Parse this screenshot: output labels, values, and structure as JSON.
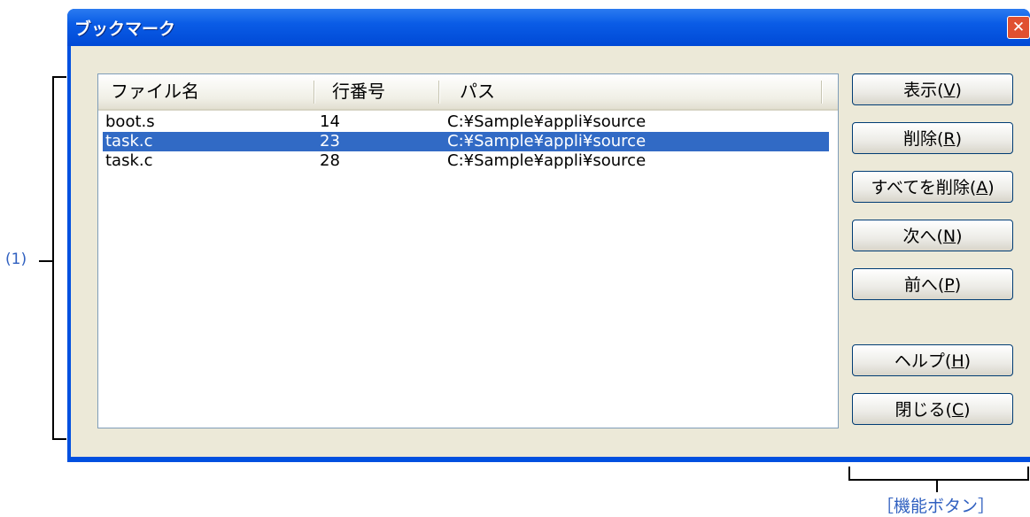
{
  "window": {
    "title": "ブックマーク",
    "close_icon": "close-icon"
  },
  "list": {
    "columns": [
      "ファイル名",
      "行番号",
      "パス"
    ],
    "rows": [
      {
        "file": "boot.s",
        "line": "14",
        "path": "C:¥Sample¥appli¥source",
        "selected": false
      },
      {
        "file": "task.c",
        "line": "23",
        "path": "C:¥Sample¥appli¥source",
        "selected": true
      },
      {
        "file": "task.c",
        "line": "28",
        "path": "C:¥Sample¥appli¥source",
        "selected": false
      }
    ]
  },
  "buttons": {
    "show": {
      "text": "表示(",
      "key": "V",
      "end": ")"
    },
    "delete": {
      "text": "削除(",
      "key": "R",
      "end": ")"
    },
    "delete_all": {
      "text": "すべてを削除(",
      "key": "A",
      "end": ")"
    },
    "next": {
      "text": "次へ(",
      "key": "N",
      "end": ")"
    },
    "prev": {
      "text": "前へ(",
      "key": "P",
      "end": ")"
    },
    "help": {
      "text": "ヘルプ(",
      "key": "H",
      "end": ")"
    },
    "close": {
      "text": "閉じる(",
      "key": "C",
      "end": ")"
    }
  },
  "annotations": {
    "area_label": "(1)",
    "buttons_label": "［機能ボタン］"
  },
  "colors": {
    "selection": "#316ac5",
    "titlebar": "#0a5ce6",
    "annotation": "#3060c0"
  }
}
